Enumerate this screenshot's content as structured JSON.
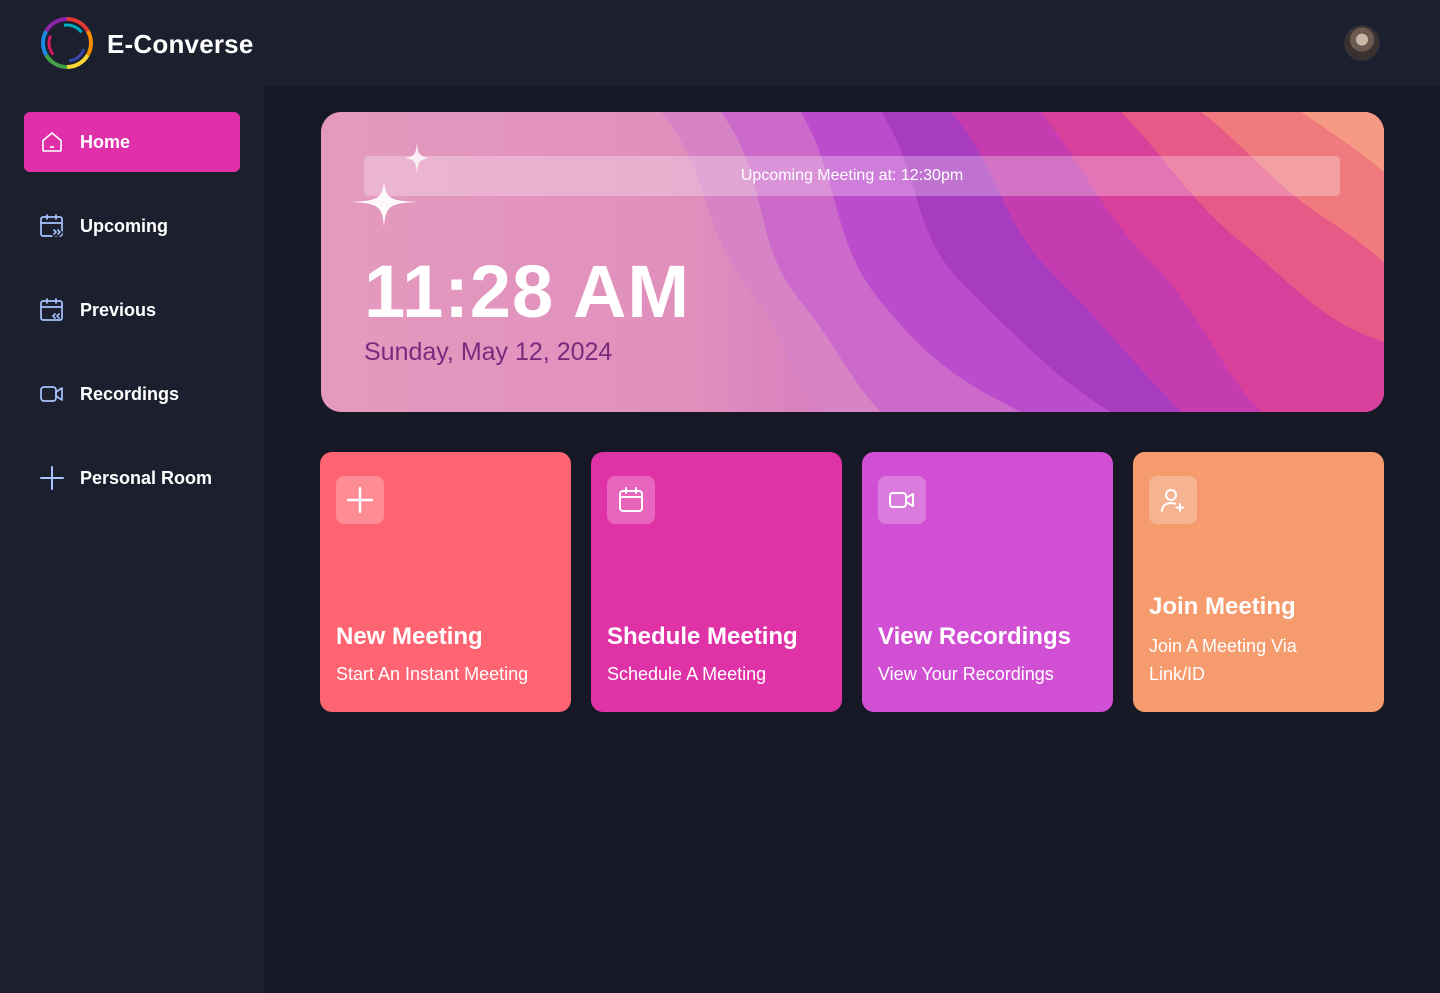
{
  "app": {
    "name": "E-Converse"
  },
  "sidebar": {
    "items": [
      {
        "label": "Home",
        "icon": "home-icon",
        "active": true
      },
      {
        "label": "Upcoming",
        "icon": "calendar-forward-icon"
      },
      {
        "label": "Previous",
        "icon": "calendar-back-icon"
      },
      {
        "label": "Recordings",
        "icon": "video-icon"
      },
      {
        "label": "Personal Room",
        "icon": "plus-icon"
      }
    ]
  },
  "hero": {
    "upcoming": "Upcoming Meeting at: 12:30pm",
    "time": "11:28 AM",
    "date": "Sunday, May 12, 2024"
  },
  "cards": [
    {
      "title": "New Meeting",
      "subtitle": "Start An Instant Meeting",
      "icon": "plus-icon",
      "color": "#ff6472"
    },
    {
      "title": "Shedule Meeting",
      "subtitle": "Schedule A Meeting",
      "icon": "calendar-icon",
      "color": "#df32a6"
    },
    {
      "title": "View Recordings",
      "subtitle": "View Your Recordings",
      "icon": "video-icon",
      "color": "#d04fd3"
    },
    {
      "title": "Join Meeting",
      "subtitle": "Join A Meeting Via Link/ID",
      "icon": "user-add-icon",
      "color": "#f59b6e"
    }
  ],
  "colors": {
    "background": "#161925",
    "panel": "#1c1f2e",
    "accent": "#df2fa9",
    "date_text": "#7a2a7d"
  }
}
